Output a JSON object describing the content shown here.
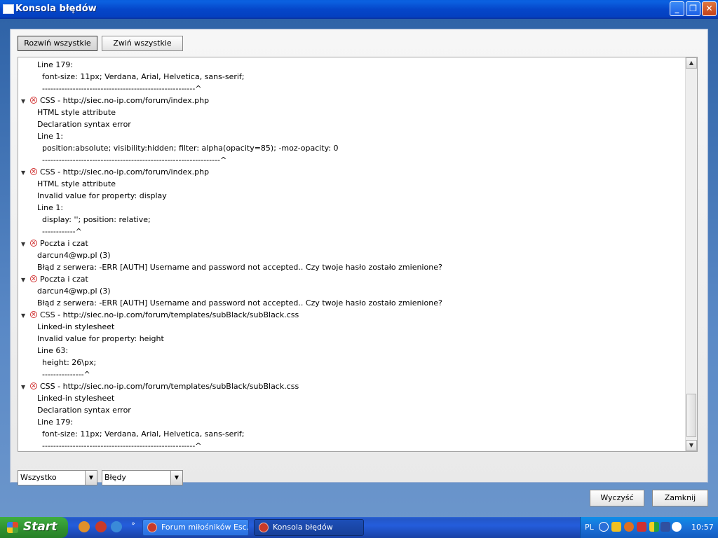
{
  "window": {
    "title": "Konsola błędów"
  },
  "toolbar": {
    "expand_all": "Rozwiń wszystkie",
    "collapse_all": "Zwiń wszystkie"
  },
  "log_lines": [
    {
      "indent": 1,
      "text": "Line 179:"
    },
    {
      "indent": 2,
      "text": "font-size: 11px; Verdana, Arial, Helvetica, sans-serif;"
    },
    {
      "indent": 2,
      "text": "-------------------------------------------------------^"
    },
    {
      "indent": 0,
      "head": true,
      "text": "CSS - http://siec.no-ip.com/forum/index.php"
    },
    {
      "indent": 1,
      "text": "HTML style attribute"
    },
    {
      "indent": 1,
      "text": "Declaration syntax error"
    },
    {
      "indent": 1,
      "text": "Line 1:"
    },
    {
      "indent": 2,
      "text": "position:absolute; visibility:hidden; filter: alpha(opacity=85); -moz-opacity: 0"
    },
    {
      "indent": 2,
      "text": "----------------------------------------------------------------^"
    },
    {
      "indent": 0,
      "head": true,
      "text": "CSS - http://siec.no-ip.com/forum/index.php"
    },
    {
      "indent": 1,
      "text": "HTML style attribute"
    },
    {
      "indent": 1,
      "text": "Invalid value for property: display"
    },
    {
      "indent": 1,
      "text": "Line 1:"
    },
    {
      "indent": 2,
      "text": "display: ''; position: relative;"
    },
    {
      "indent": 2,
      "text": "------------^"
    },
    {
      "indent": 0,
      "head": true,
      "text": "Poczta i czat"
    },
    {
      "indent": 1,
      "text": "darcun4@wp.pl (3)"
    },
    {
      "indent": 1,
      "text": "Błąd z serwera: -ERR [AUTH] Username and password not accepted.. Czy twoje hasło zostało zmienione?"
    },
    {
      "indent": 0,
      "head": true,
      "text": "Poczta i czat"
    },
    {
      "indent": 1,
      "text": "darcun4@wp.pl (3)"
    },
    {
      "indent": 1,
      "text": "Błąd z serwera: -ERR [AUTH] Username and password not accepted.. Czy twoje hasło zostało zmienione?"
    },
    {
      "indent": 0,
      "head": true,
      "text": "CSS - http://siec.no-ip.com/forum/templates/subBlack/subBlack.css"
    },
    {
      "indent": 1,
      "text": "Linked-in stylesheet"
    },
    {
      "indent": 1,
      "text": "Invalid value for property: height"
    },
    {
      "indent": 1,
      "text": "Line 63:"
    },
    {
      "indent": 2,
      "text": "height: 26\\px;"
    },
    {
      "indent": 2,
      "text": "---------------^"
    },
    {
      "indent": 0,
      "head": true,
      "text": "CSS - http://siec.no-ip.com/forum/templates/subBlack/subBlack.css"
    },
    {
      "indent": 1,
      "text": "Linked-in stylesheet"
    },
    {
      "indent": 1,
      "text": "Declaration syntax error"
    },
    {
      "indent": 1,
      "text": "Line 179:"
    },
    {
      "indent": 2,
      "text": "font-size: 11px; Verdana, Arial, Helvetica, sans-serif;"
    },
    {
      "indent": 2,
      "text": "-------------------------------------------------------^"
    }
  ],
  "filters": {
    "source_value": "Wszystko",
    "type_value": "Błędy"
  },
  "footer": {
    "clear_label": "Wyczyść",
    "close_label": "Zamknij"
  },
  "taskbar": {
    "start_label": "Start",
    "tasks": [
      {
        "label": "Forum miłośników Esc..."
      },
      {
        "label": "Konsola błędów"
      }
    ],
    "lang": "PL",
    "clock": "10:57"
  }
}
